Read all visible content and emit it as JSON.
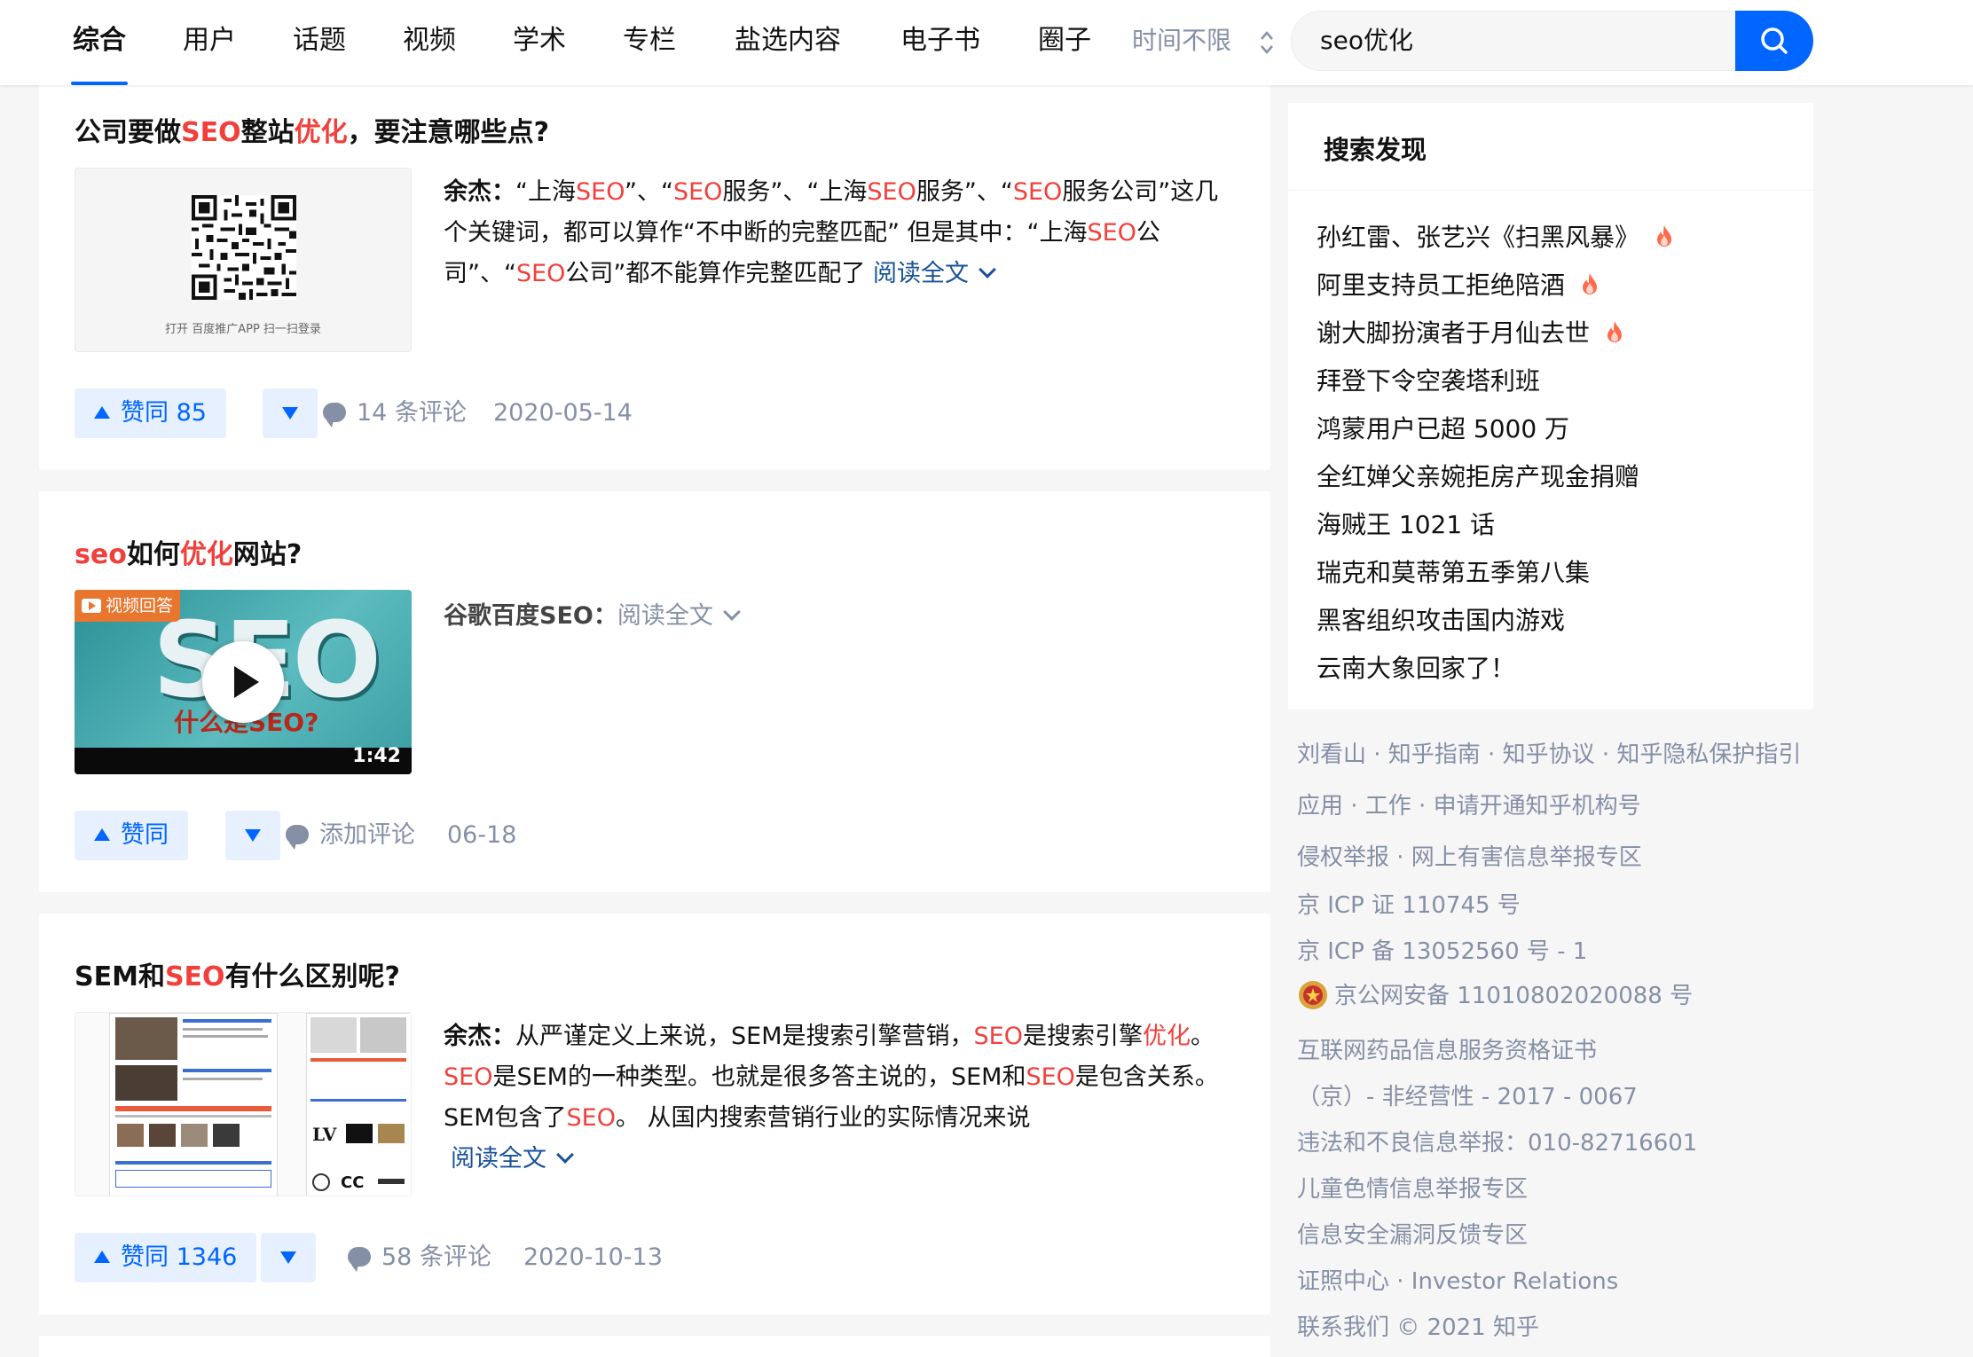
{
  "nav": {
    "tabs": [
      "综合",
      "用户",
      "话题",
      "视频",
      "学术",
      "专栏",
      "盐选内容",
      "电子书",
      "圈子"
    ],
    "time_filter": "时间不限",
    "search_value": "seo优化"
  },
  "results": [
    {
      "title_parts": [
        "公司要做",
        "SEO",
        "整站",
        "优化",
        "，要注意哪些点?"
      ],
      "thumb_caption": "打开 百度推广APP 扫一扫登录",
      "author": "余杰：",
      "excerpt_parts": [
        "“上海",
        "SEO",
        "”、“",
        "SEO",
        "服务”、“上海",
        "SEO",
        "服务”、“",
        "SEO",
        "服务公司”这几个关键词，都可以算作“不中断的完整匹配” 但是其中：“上海",
        "SEO",
        "公司”、“",
        "SEO",
        "公司”都不能算作完整匹配了 "
      ],
      "read_more": "阅读全文",
      "vote_label": "赞同 85",
      "comments": "14 条评论",
      "date": "2020-05-14"
    },
    {
      "title_parts": [
        "seo",
        "如何",
        "优化",
        "网站?"
      ],
      "video_badge": "视频回答",
      "video_duration": "1:42",
      "video_text": "SEO",
      "video_subtext": "什么是SEO?",
      "author": "谷歌百度SEO：",
      "read_more": "阅读全文",
      "vote_label": "赞同",
      "comments": "添加评论",
      "date": "06-18"
    },
    {
      "title_parts": [
        "SEM和",
        "SEO",
        "有什么区别呢?"
      ],
      "author": "余杰：",
      "excerpt_parts": [
        "从严谨定义上来说，SEM是搜索引擎营销，",
        "SEO",
        "是搜索引擎",
        "优化",
        "。",
        "SEO",
        "是SEM的一种类型。也就是很多答主说的，SEM和",
        "SEO",
        "是包含关系。SEM包含了",
        "SEO",
        "。 从国内搜索营销行业的实际情况来说"
      ],
      "read_more": "阅读全文",
      "vote_label": "赞同 1346",
      "comments": "58 条评论",
      "date": "2020-10-13"
    }
  ],
  "sidebar": {
    "title": "搜索发现",
    "hot_items": [
      {
        "text": "孙红雷、张艺兴《扫黑风暴》",
        "hot": true
      },
      {
        "text": "阿里支持员工拒绝陪酒",
        "hot": true
      },
      {
        "text": "谢大脚扮演者于月仙去世",
        "hot": true
      },
      {
        "text": "拜登下令空袭塔利班",
        "hot": false
      },
      {
        "text": "鸿蒙用户已超 5000 万",
        "hot": false
      },
      {
        "text": "全红婵父亲婉拒房产现金捐赠",
        "hot": false
      },
      {
        "text": "海贼王 1021 话",
        "hot": false
      },
      {
        "text": "瑞克和莫蒂第五季第八集",
        "hot": false
      },
      {
        "text": "黑客组织攻击国内游戏",
        "hot": false
      },
      {
        "text": "云南大象回家了！",
        "hot": false
      }
    ],
    "footer": [
      "刘看山 · 知乎指南 · 知乎协议 · 知乎隐私保护指引",
      "应用 · 工作 · 申请开通知乎机构号",
      "侵权举报 · 网上有害信息举报专区",
      "京 ICP 证 110745 号",
      "京 ICP 备 13052560 号 - 1",
      "京公网安备 11010802020088 号",
      "互联网药品信息服务资格证书",
      "（京）- 非经营性 - 2017 - 0067",
      "违法和不良信息举报：010-82716601",
      "儿童色情信息举报专区",
      "信息安全漏洞反馈专区",
      "证照中心 · Investor Relations",
      "联系我们 © 2021 知乎"
    ]
  },
  "colors": {
    "accent": "#0066ff",
    "highlight": "#f1403c",
    "link": "#175199",
    "meta": "#8590a6"
  }
}
